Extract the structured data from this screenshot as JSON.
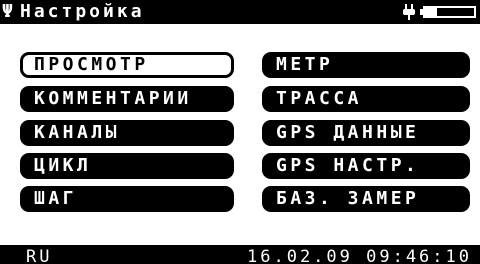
{
  "title_bar": {
    "icon": "Ψ",
    "title": "Настройка",
    "status_icons": [
      "plug-icon",
      "battery-icon"
    ],
    "battery_level": 0.25
  },
  "menu": {
    "left": [
      {
        "label": "ПРОСМОТР",
        "selected": true
      },
      {
        "label": "КОММЕНТАРИИ",
        "selected": false
      },
      {
        "label": "КАНАЛЫ",
        "selected": false
      },
      {
        "label": "ЦИКЛ",
        "selected": false
      },
      {
        "label": "ШАГ",
        "selected": false
      }
    ],
    "right": [
      {
        "label": "МЕТР",
        "selected": false
      },
      {
        "label": "ТРАССА",
        "selected": false
      },
      {
        "label": "GPS ДАННЫЕ",
        "selected": false
      },
      {
        "label": "GPS НАСТР.",
        "selected": false
      },
      {
        "label": "БАЗ. ЗАМЕР",
        "selected": false
      }
    ]
  },
  "footer": {
    "language": "RU",
    "datetime": "16.02.09 09:46:10"
  },
  "colors": {
    "foreground": "#000000",
    "background": "#ffffff"
  }
}
